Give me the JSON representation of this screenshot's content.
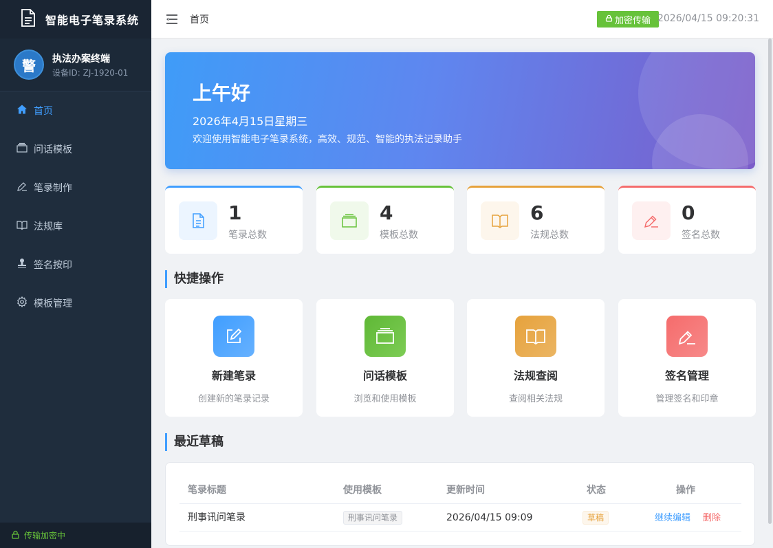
{
  "app": {
    "title": "智能电子笔录系统"
  },
  "device": {
    "avatar": "警",
    "name": "执法办案终端",
    "id": "设备ID: ZJ-1920-01"
  },
  "sidebar": {
    "items": [
      {
        "label": "首页",
        "icon": "home-icon",
        "active": true
      },
      {
        "label": "问话模板",
        "icon": "template-icon"
      },
      {
        "label": "笔录制作",
        "icon": "edit-icon"
      },
      {
        "label": "法规库",
        "icon": "book-icon"
      },
      {
        "label": "签名按印",
        "icon": "stamp-icon"
      },
      {
        "label": "模板管理",
        "icon": "gear-icon"
      }
    ],
    "footer": "传输加密中"
  },
  "header": {
    "breadcrumb": "首页",
    "badge": "加密传输",
    "datetime": "2026/04/15 09:20:31"
  },
  "hero": {
    "greeting": "上午好",
    "date": "2026年4月15日星期三",
    "subtitle": "欢迎使用智能电子笔录系统，高效、规范、智能的执法记录助手"
  },
  "stats": [
    {
      "value": "1",
      "label": "笔录总数",
      "color": "#409eff"
    },
    {
      "value": "4",
      "label": "模板总数",
      "color": "#67c23a"
    },
    {
      "value": "6",
      "label": "法规总数",
      "color": "#e6a23c"
    },
    {
      "value": "0",
      "label": "签名总数",
      "color": "#f56c6c"
    }
  ],
  "quick": {
    "title": "快捷操作",
    "items": [
      {
        "title": "新建笔录",
        "desc": "创建新的笔录记录"
      },
      {
        "title": "问话模板",
        "desc": "浏览和使用模板"
      },
      {
        "title": "法规查阅",
        "desc": "查阅相关法规"
      },
      {
        "title": "签名管理",
        "desc": "管理签名和印章"
      }
    ]
  },
  "drafts": {
    "title": "最近草稿",
    "columns": [
      "笔录标题",
      "使用模板",
      "更新时间",
      "状态",
      "操作"
    ],
    "rows": [
      {
        "title": "刑事讯问笔录",
        "template": "刑事讯问笔录",
        "updated": "2026/04/15 09:09",
        "status": "草稿",
        "edit": "继续编辑",
        "delete": "删除"
      }
    ]
  }
}
